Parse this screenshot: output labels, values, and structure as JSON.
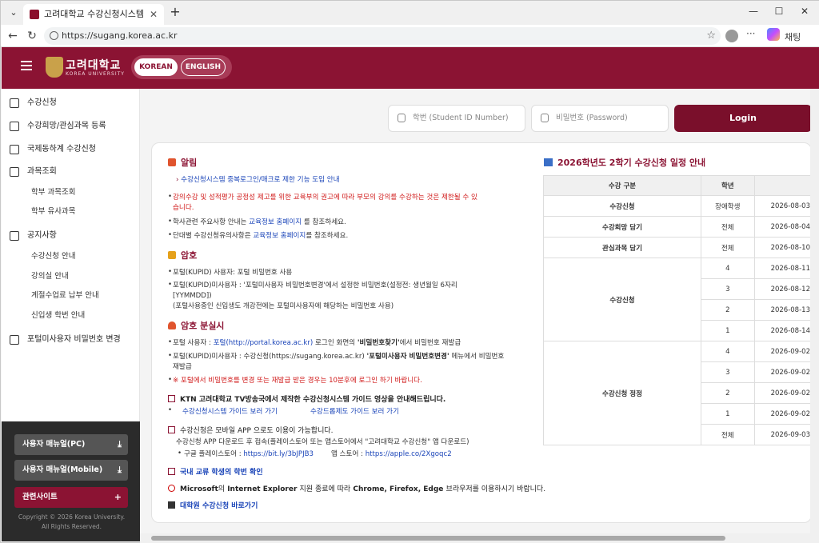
{
  "browser": {
    "tab_title": "고려대학교 수강신청시스템",
    "url": "https://sugang.korea.ac.kr",
    "profile_label": "채팅",
    "win_min": "—",
    "win_max": "☐",
    "win_close": "✕",
    "tab_close": "✕",
    "new_tab": "+",
    "more": "···",
    "star": "☆"
  },
  "header": {
    "logo_text": "고려대학교",
    "logo_sub": "KOREA UNIVERSITY",
    "lang_korean": "KOREAN",
    "lang_english": "ENGLISH",
    "brand_color": "#8b1333"
  },
  "sidebar": {
    "items": [
      {
        "label": "수강신청",
        "icon": "edit-icon"
      },
      {
        "label": "수강희망/관심과목 등록",
        "icon": "cart-icon"
      },
      {
        "label": "국제동하계 수강신청",
        "icon": "edit-icon"
      },
      {
        "label": "과목조회",
        "icon": "search-doc-icon"
      },
      {
        "label": "공지사항",
        "icon": "megaphone-icon"
      },
      {
        "label": "포털미사용자 비밀번호 변경",
        "icon": "lock-icon"
      }
    ],
    "sub_course": [
      "학부 과목조회",
      "학부 유사과목"
    ],
    "sub_notice": [
      "수강신청 안내",
      "강의실 안내",
      "계절수업료 납부 안내",
      "신입생 학번 안내"
    ],
    "btn_manual_pc": "사용자 매뉴얼(PC)",
    "btn_manual_mobile": "사용자 매뉴얼(Mobile)",
    "btn_related": "관련사이트",
    "download_glyph": "⤓",
    "plus_glyph": "+",
    "copyright1": "Copyright © 2026 Korea University.",
    "copyright2": "All Rights Reserved."
  },
  "login": {
    "id_placeholder": "학번 (Student ID Number)",
    "pw_placeholder": "비밀번호 (Password)",
    "button": "Login"
  },
  "notice": {
    "alert_title": "알림",
    "alert_link": "수강신청시스템 중복로그인/매크로 제한 기능 도입 안내",
    "alert_red1": "강의수강 및 성적평가 공정성 제고를 위한 교육부의 권고에 따라 부모의 강의를 수강하는 것은 제한될 수 있",
    "alert_red2": "습니다.",
    "alert_l3a": "학사관련 주요사항 안내는",
    "alert_l3b": "교육정보 홈페이지",
    "alert_l3c": "를 참조하세요.",
    "alert_l4a": "단대별 수강신청유의사항은",
    "alert_l4b": "교육정보 홈페이지",
    "alert_l4c": "를 참조하세요.",
    "pw_title": "암호",
    "pw_l1": "포털(KUPID) 사용자: 포털 비밀번호 사용",
    "pw_l2a": "포털(KUPID)미사용자 : '포털미사용자 비밀번호변경'에서 설정한 비밀번호(설정전: 생년월일 6자리",
    "pw_l2b": "[YYMMDD])",
    "pw_l3": "(포털사용중인 신입생도 개강전에는 포털미사용자에 해당하는 비밀번호 사용)",
    "lost_title": "암호 분실시",
    "lost_l1a": "포털 사용자 :",
    "lost_l1b": "포털(http://portal.korea.ac.kr)",
    "lost_l1c": "로그인 화면의",
    "lost_l1d": "'비밀번호찾기'",
    "lost_l1e": "에서 비밀번호 재발급",
    "lost_l2a": "포털(KUPID)미사용자 : 수강신청(https://sugang.korea.ac.kr)",
    "lost_l2b": "'포털미사용자 비밀번호변경'",
    "lost_l2c": "메뉴에서 비밀번호",
    "lost_l2d": "재발급",
    "lost_red": "※ 포털에서 비밀번호를 변경 또는 재발급 받은 경우는 10분후에 로그인 하기 바랍니다.",
    "ktn": "KTN 고려대학교 TV방송국에서 제작한 수강신청시스템 가이드 영상을 안내해드립니다.",
    "ktn_link1": "수강신청시스템 가이드 보러 가기",
    "ktn_link2": "수강드롭제도 가이드 보러 가기",
    "app_title": "수강신청은 모바일 APP 으로도 이용이 가능합니다.",
    "app_l1": "수강신청 APP 다운로드 후 접속(플레이스토어 또는 앱스토어에서 \"고려대학교 수강신청\" 앱 다운로드)",
    "app_l2a": "구글 플레이스토어 :",
    "app_l2b": "https://bit.ly/3bJPJB3",
    "app_l2c": "앱 스토어 :",
    "app_l2d": "https://apple.co/2Xgoqc2",
    "exchange": "국내 교류 학생의 학번 확인",
    "ie_a": "Microsoft",
    "ie_b": "의",
    "ie_c": "Internet Explorer",
    "ie_d": "지원 종료에 따라",
    "ie_e": "Chrome, Firefox, Edge",
    "ie_f": "브라우저를 이용하시기 바랍니다.",
    "grad": "대학원 수강신청 바로가기"
  },
  "schedule": {
    "title": "2026학년도 2학기 수강신청 일정 안내",
    "headers": [
      "수강 구분",
      "학년",
      ""
    ],
    "rows": [
      {
        "group": "수강신청",
        "span": 1,
        "grade": "장애학생",
        "date": "2026-08-03"
      },
      {
        "group": "수강희망 담기",
        "span": 1,
        "grade": "전체",
        "date": "2026-08-04"
      },
      {
        "group": "관심과목 담기",
        "span": 1,
        "grade": "전체",
        "date": "2026-08-10"
      },
      {
        "group": "수강신청",
        "span": 4,
        "grade": "4",
        "date": "2026-08-11"
      },
      {
        "group": "",
        "span": 0,
        "grade": "3",
        "date": "2026-08-12"
      },
      {
        "group": "",
        "span": 0,
        "grade": "2",
        "date": "2026-08-13"
      },
      {
        "group": "",
        "span": 0,
        "grade": "1",
        "date": "2026-08-14"
      },
      {
        "group": "수강신청 정정",
        "span": 5,
        "grade": "4",
        "date": "2026-09-02"
      },
      {
        "group": "",
        "span": 0,
        "grade": "3",
        "date": "2026-09-02"
      },
      {
        "group": "",
        "span": 0,
        "grade": "2",
        "date": "2026-09-02"
      },
      {
        "group": "",
        "span": 0,
        "grade": "1",
        "date": "2026-09-02"
      },
      {
        "group": "",
        "span": 0,
        "grade": "전체",
        "date": "2026-09-03"
      }
    ]
  }
}
